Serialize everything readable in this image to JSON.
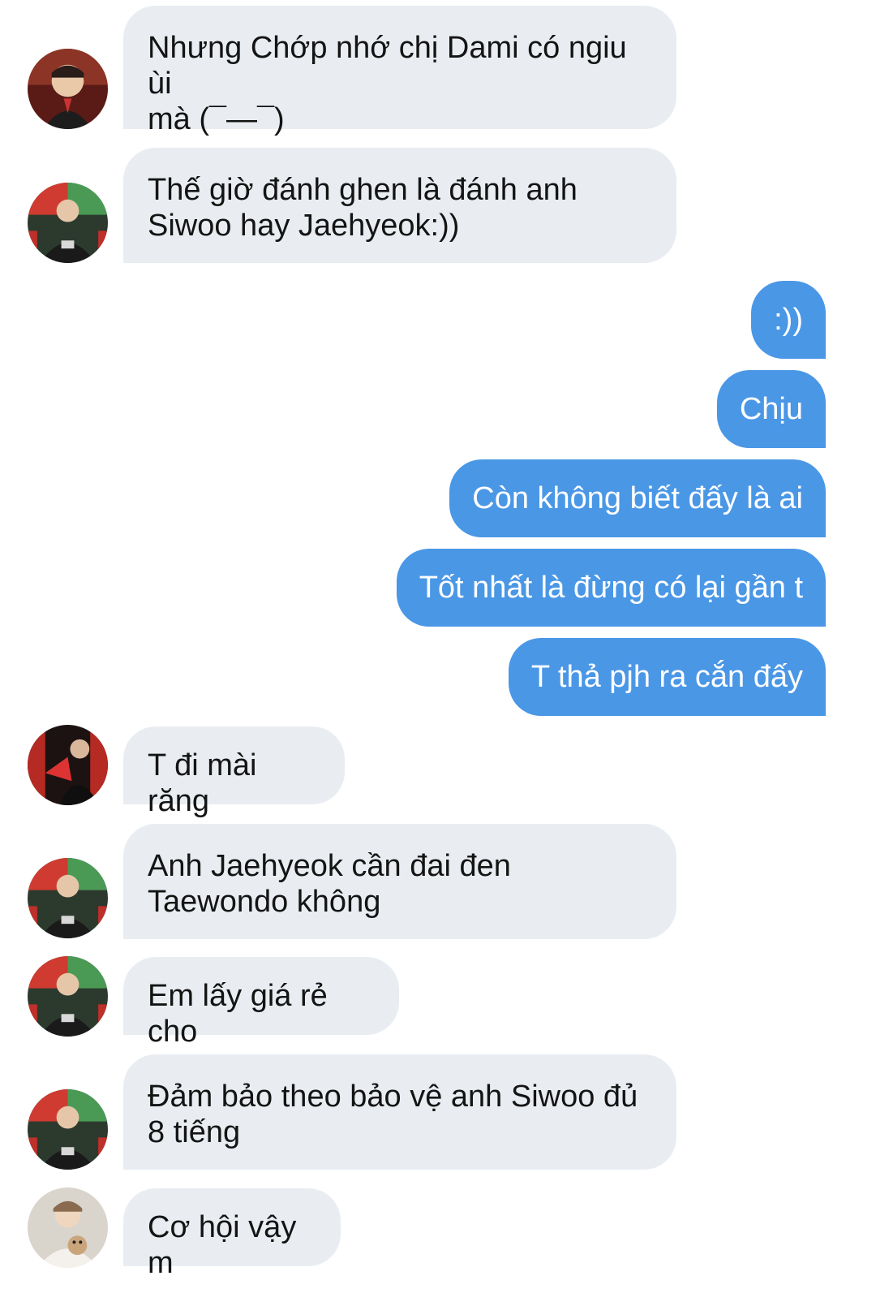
{
  "messages": [
    {
      "from": "other",
      "avatar": "avatar-a",
      "text": "Nhưng Chớp nhớ chị Dami có ngiu ùi\nmà (¯—¯)"
    },
    {
      "from": "other",
      "avatar": "avatar-b",
      "text": "Thế giờ đánh ghen là đánh anh\nSiwoo hay Jaehyeok:))"
    },
    {
      "from": "me",
      "text": ":))"
    },
    {
      "from": "me",
      "text": "Chịu"
    },
    {
      "from": "me",
      "text": "Còn không biết đấy là ai"
    },
    {
      "from": "me",
      "text": "Tốt nhất là đừng có lại gần t"
    },
    {
      "from": "me",
      "text": "T thả pjh ra cắn đấy"
    },
    {
      "from": "other",
      "avatar": "avatar-c",
      "text": "T đi mài răng"
    },
    {
      "from": "other",
      "avatar": "avatar-b",
      "text": "Anh Jaehyeok cần đai đen\nTaewondo không"
    },
    {
      "from": "other",
      "avatar": "avatar-b",
      "text": "Em lấy giá rẻ cho"
    },
    {
      "from": "other",
      "avatar": "avatar-b",
      "text": "Đảm bảo theo bảo vệ anh Siwoo đủ\n8 tiếng"
    },
    {
      "from": "other",
      "avatar": "avatar-d",
      "text": "Cơ hội vậy m"
    }
  ],
  "colors": {
    "incoming_bubble": "#e9edf1",
    "outgoing_bubble": "#4a97e6",
    "incoming_text": "#141414",
    "outgoing_text": "#ffffff"
  }
}
